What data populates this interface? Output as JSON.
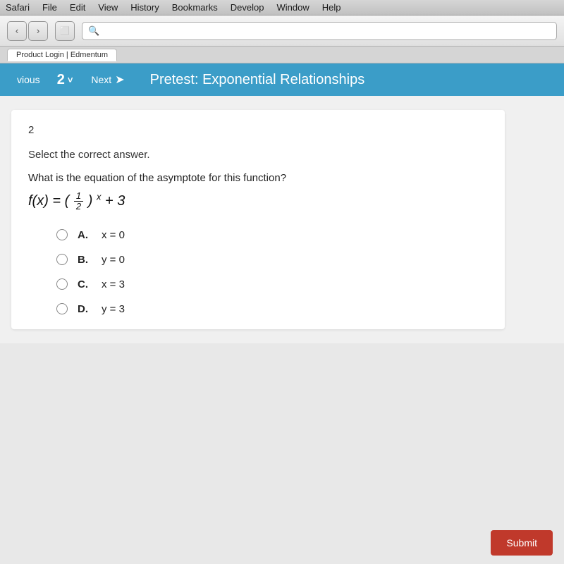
{
  "menubar": {
    "items": [
      "Safari",
      "File",
      "Edit",
      "View",
      "History",
      "Bookmarks",
      "Develop",
      "Window",
      "Help"
    ]
  },
  "toolbar": {
    "back_label": "‹",
    "forward_label": "›",
    "tab_icon": "⬜",
    "search_placeholder": ""
  },
  "tabbar": {
    "tab_label": "Product Login | Edmentum"
  },
  "edmentum_nav": {
    "prev_label": "vious",
    "question_number": "2",
    "chevron": "˅",
    "next_label": "Next",
    "next_arrow": "➤",
    "pretest_title": "Pretest: Exponential Relationships"
  },
  "question": {
    "number": "2",
    "instruction": "Select the correct answer.",
    "question_text": "What is the equation of the asymptote for this function?",
    "options": [
      {
        "id": "A",
        "value": "x = 0"
      },
      {
        "id": "B",
        "value": "y = 0"
      },
      {
        "id": "C",
        "value": "x = 3"
      },
      {
        "id": "D",
        "value": "y = 3"
      }
    ]
  }
}
